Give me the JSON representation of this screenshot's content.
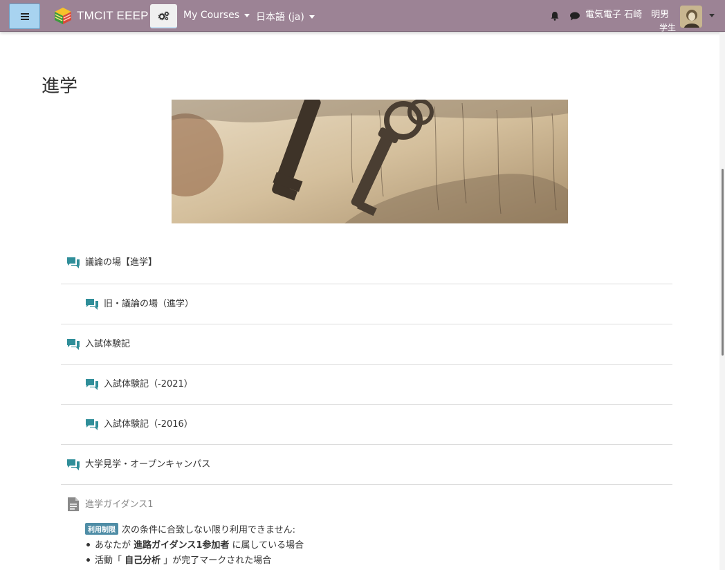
{
  "navbar": {
    "site_name": "TMCIT EEEP",
    "menu_courses": "My Courses",
    "menu_language": "日本語 (ja)",
    "user_name": "電気電子 石崎　明男",
    "user_role": "学生",
    "colors": {
      "navbar_bg": "#9c8395",
      "toggle_bg": "#a8d3f0"
    }
  },
  "page": {
    "title": "進学"
  },
  "activities": [
    {
      "label": "議論の場【進学】",
      "level": 0,
      "icon": "forum-icon"
    },
    {
      "label": "旧・議論の場（進学）",
      "level": 1,
      "icon": "forum-icon"
    },
    {
      "label": "入試体験記",
      "level": 0,
      "icon": "forum-icon"
    },
    {
      "label": "入試体験記（-2021）",
      "level": 1,
      "icon": "forum-icon"
    },
    {
      "label": "入試体験記（-2016）",
      "level": 1,
      "icon": "forum-icon"
    },
    {
      "label": "大学見学・オープンキャンパス",
      "level": 0,
      "icon": "forum-icon"
    }
  ],
  "resource": {
    "name": "進学ガイダンス1",
    "icon": "file-icon",
    "badge": "利用制限",
    "restriction_text": "次の条件に合致しない限り利用できません:",
    "conditions": [
      {
        "pre": "あなたが ",
        "bold": "進路ガイダンス1参加者",
        "post": " に属している場合"
      },
      {
        "pre": "活動「 ",
        "bold": "自己分析",
        "post": " 」が完了マークされた場合"
      }
    ]
  }
}
